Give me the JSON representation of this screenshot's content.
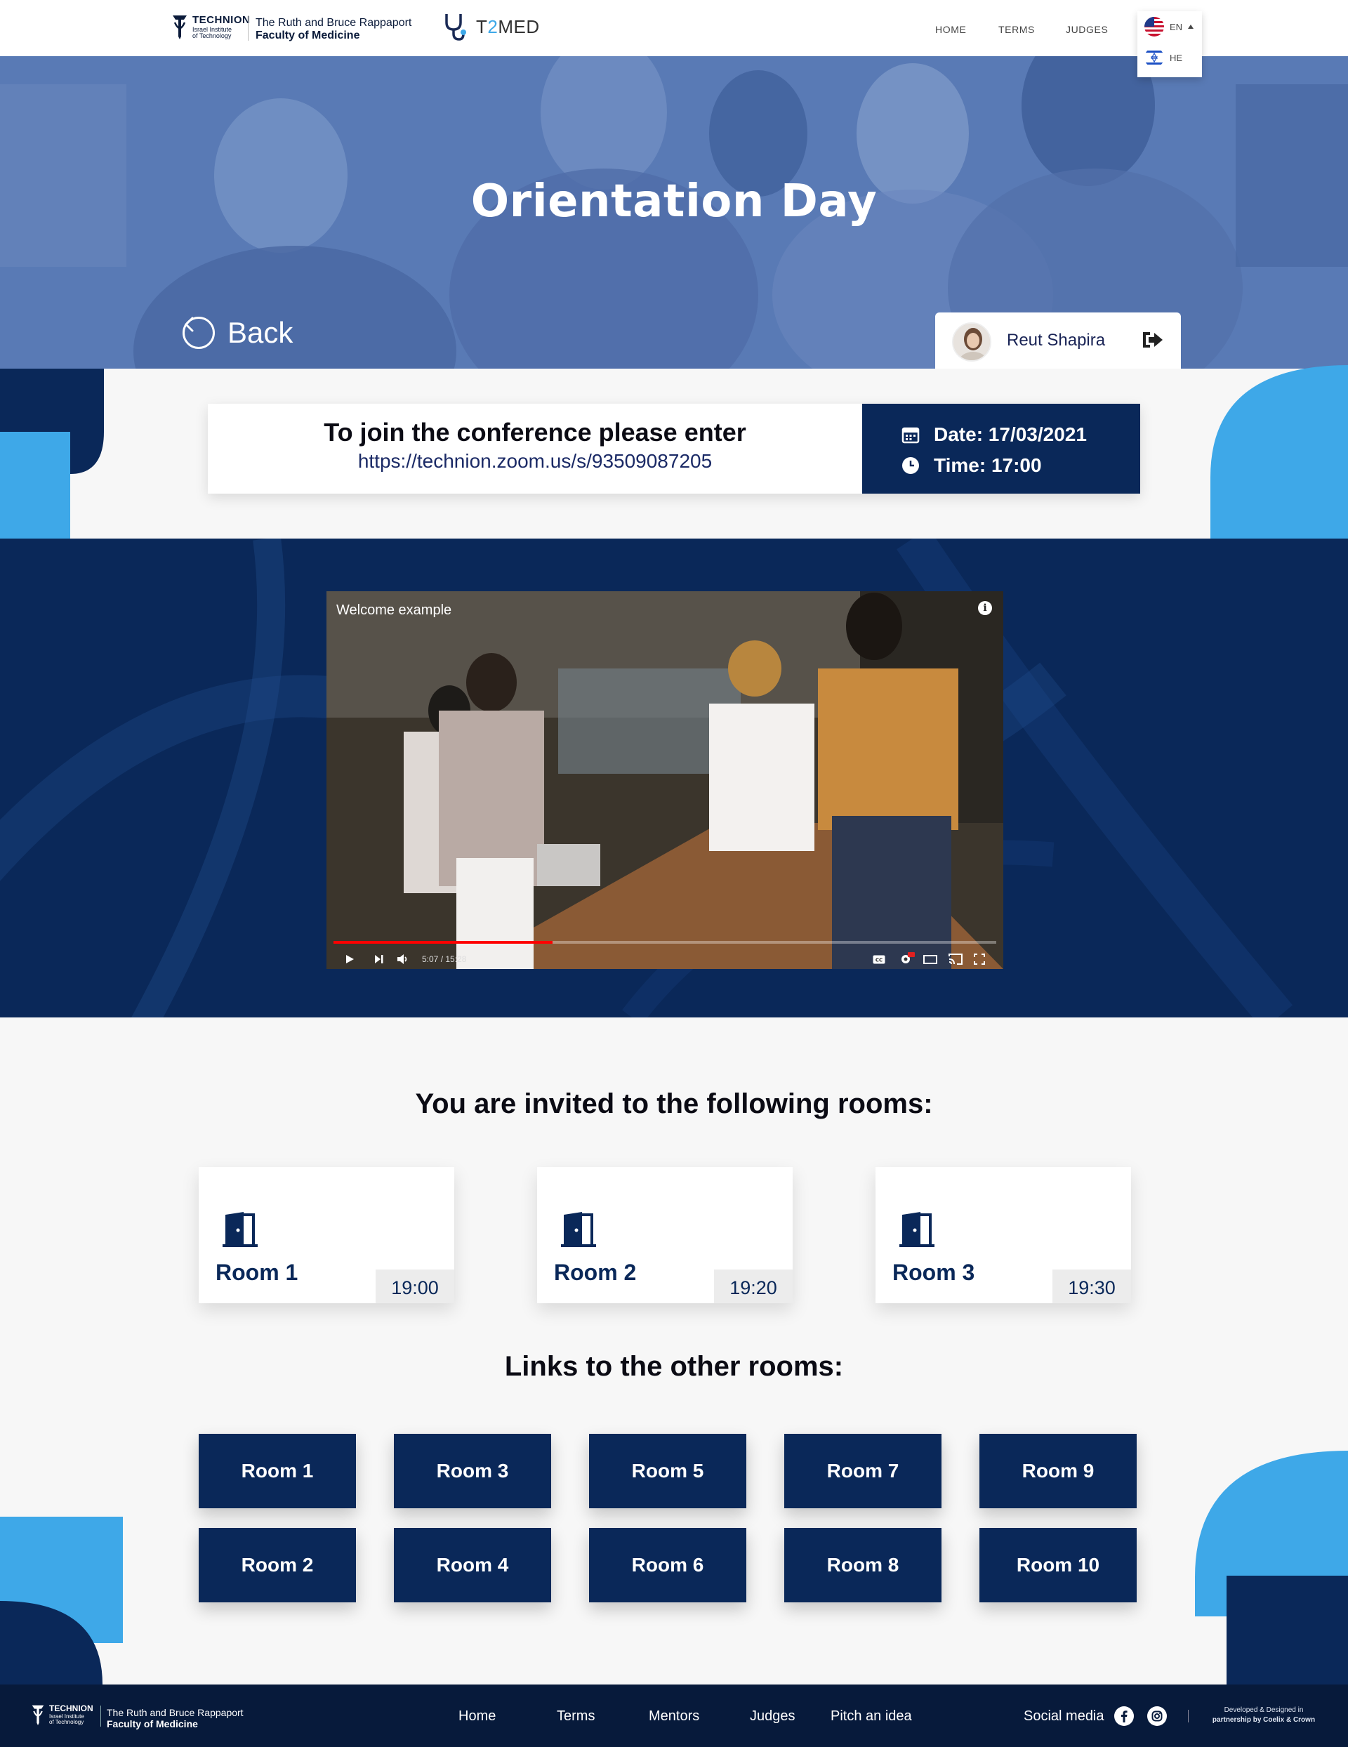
{
  "nav": {
    "technion": {
      "name": "TECHNION",
      "sub1": "Israel Institute",
      "sub2": "of Technology"
    },
    "faculty": {
      "line1": "The Ruth and Bruce Rappaport",
      "line2": "Faculty of Medicine"
    },
    "brand": {
      "prefix": "T",
      "accent": "2",
      "suffix": "MED"
    },
    "menu": [
      "HOME",
      "TERMS",
      "JUDGES"
    ],
    "languages": [
      {
        "code": "EN",
        "flag": "us-flag-icon"
      },
      {
        "code": "HE",
        "flag": "israel-flag-icon"
      }
    ]
  },
  "hero": {
    "title": "Orientation Day",
    "back_label": "Back",
    "user_name": "Reut Shapira"
  },
  "conference": {
    "heading": "To join the conference please enter",
    "link": "https://technion.zoom.us/s/93509087205",
    "date": "Date: 17/03/2021",
    "time": "Time: 17:00"
  },
  "video": {
    "title": "Welcome example",
    "timestamp": "5:07 / 15:28",
    "progress": 0.33,
    "buffered": 0.5
  },
  "invited": {
    "heading": "You are invited to the following rooms:",
    "rooms": [
      {
        "name": "Room 1",
        "time": "19:00"
      },
      {
        "name": "Room 2",
        "time": "19:20"
      },
      {
        "name": "Room 3",
        "time": "19:30"
      }
    ]
  },
  "other": {
    "heading": "Links to the other rooms:",
    "rooms": [
      "Room 1",
      "Room 3",
      "Room 5",
      "Room 7",
      "Room 9",
      "Room 2",
      "Room 4",
      "Room 6",
      "Room 8",
      "Room 10"
    ]
  },
  "footer": {
    "technion": {
      "name": "TECHNION",
      "sub1": "Israel Institute",
      "sub2": "of Technology"
    },
    "faculty": {
      "line1": "The Ruth and Bruce Rappaport",
      "line2": "Faculty of Medicine"
    },
    "links": [
      "Home",
      "Terms",
      "Mentors",
      "Judges",
      "Pitch an idea"
    ],
    "social_label": "Social media",
    "social_icons": [
      "facebook-icon",
      "instagram-icon"
    ],
    "credit_line1": "Developed & Designed in",
    "credit_line2": "partnership by Coelix & Crown"
  },
  "colors": {
    "navy": "#0a2859",
    "light_blue": "#3ea8e8",
    "hero_overlay": "#5b7bb5"
  }
}
